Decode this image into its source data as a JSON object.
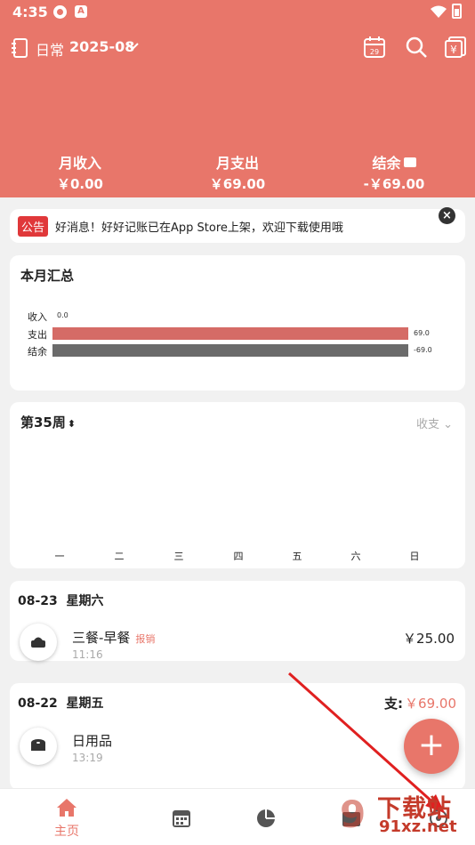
{
  "status": {
    "time": "4:35"
  },
  "toolbar": {
    "book_name": "日常",
    "month": "2025-08",
    "calendar_day": "29"
  },
  "summary_header": {
    "income_label": "月收入",
    "income_value": "￥0.00",
    "expense_label": "月支出",
    "expense_value": "￥69.00",
    "balance_label": "结余",
    "balance_value": "-￥69.00"
  },
  "notice": {
    "badge": "公告",
    "text": "好消息！好好记账已在App Store上架，欢迎下载使用哦"
  },
  "monthly_summary": {
    "title": "本月汇总",
    "rows": [
      {
        "label": "收入",
        "value": "0.0"
      },
      {
        "label": "支出",
        "value": "69.0"
      },
      {
        "label": "结余",
        "value": "-69.0"
      }
    ]
  },
  "week_chart": {
    "title": "第35周",
    "filter_label": "收支",
    "days": [
      "一",
      "二",
      "三",
      "四",
      "五",
      "六",
      "日"
    ]
  },
  "transactions": [
    {
      "date": "08-23",
      "weekday": "星期六",
      "items": [
        {
          "name": "三餐-早餐",
          "tag": "报销",
          "time": "11:16",
          "amount": "￥25.00"
        }
      ]
    },
    {
      "date": "08-22",
      "weekday": "星期五",
      "total_label": "支:",
      "total_value": "￥69.00",
      "items": [
        {
          "name": "日用品",
          "time": "13:19",
          "amount": ""
        }
      ]
    }
  ],
  "tabs": [
    {
      "label": "主页",
      "icon": "home-icon"
    },
    {
      "label": "",
      "icon": "calendar-icon"
    },
    {
      "label": "",
      "icon": "pie-chart-icon"
    },
    {
      "label": "",
      "icon": "wallet-icon"
    },
    {
      "label": "",
      "icon": "profile-icon"
    }
  ],
  "watermark": {
    "text": "下载站",
    "url": "91xz.net"
  },
  "colors": {
    "accent": "#e8766a",
    "expense_bar": "#d56b66",
    "balance_bar": "#6b6b6b",
    "notice_badge": "#e0383a"
  },
  "chart_data": {
    "type": "bar",
    "orientation": "horizontal",
    "categories": [
      "收入",
      "支出",
      "结余"
    ],
    "values": [
      0.0,
      69.0,
      -69.0
    ]
  }
}
